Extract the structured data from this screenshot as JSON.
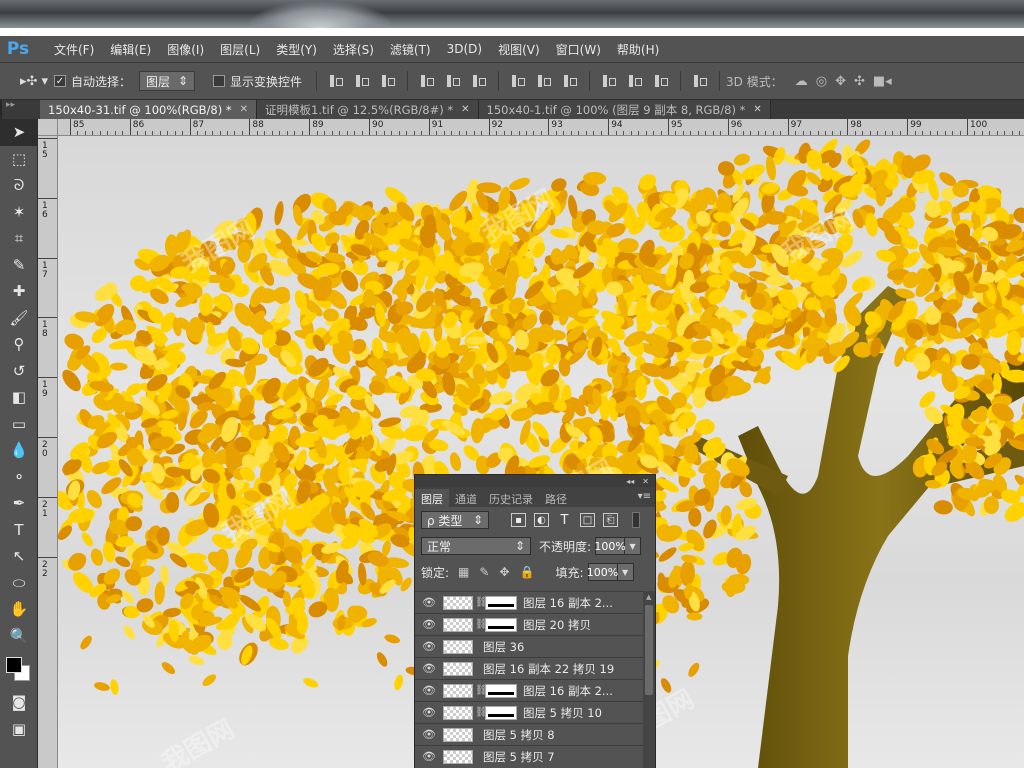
{
  "app": {
    "logo": "Ps"
  },
  "menu": [
    "文件(F)",
    "编辑(E)",
    "图像(I)",
    "图层(L)",
    "类型(Y)",
    "选择(S)",
    "滤镜(T)",
    "3D(D)",
    "视图(V)",
    "窗口(W)",
    "帮助(H)"
  ],
  "options": {
    "tool_icon": "▸✣ ▾",
    "auto_select_checked": true,
    "auto_select_label": "自动选择：",
    "auto_select_target": "图层",
    "show_transform_label": "显示变换控件",
    "show_transform_checked": false,
    "mode_3d_label": "3D 模式："
  },
  "tabs": [
    {
      "label": "150x40-31.tif @ 100%(RGB/8) *",
      "active": true
    },
    {
      "label": "证明模板1.tif @ 12.5%(RGB/8#) *",
      "active": false
    },
    {
      "label": "150x40-1.tif @ 100% (图层 9 副本 8, RGB/8) *",
      "active": false
    }
  ],
  "ruler": {
    "top": [
      "85",
      "86",
      "87",
      "88",
      "89",
      "90",
      "91",
      "92",
      "93",
      "94",
      "95",
      "96",
      "97",
      "98",
      "99",
      "100"
    ],
    "left": [
      "1\n5",
      "1\n6",
      "1\n7",
      "1\n8",
      "1\n9",
      "2\n0",
      "2\n1",
      "2\n2"
    ]
  },
  "tools": [
    "move",
    "marquee",
    "lasso",
    "magic-wand",
    "crop",
    "eyedropper",
    "healing",
    "brush",
    "stamp",
    "history-brush",
    "eraser",
    "gradient",
    "blur",
    "dodge",
    "pen",
    "type",
    "path-select",
    "shape",
    "hand",
    "zoom"
  ],
  "colors": {
    "foreground": "#000000",
    "background": "#ffffff",
    "leaf_light": "#ffd200",
    "leaf_mid": "#f0b400",
    "leaf_dark": "#d98c00",
    "trunk": "#7a6510"
  },
  "layers_panel": {
    "tabs": [
      "图层",
      "通道",
      "历史记录",
      "路径"
    ],
    "filter_label": "ρ 类型",
    "blend_mode": "正常",
    "opacity_label": "不透明度:",
    "opacity_value": "100%",
    "lock_label": "锁定:",
    "fill_label": "填充:",
    "fill_value": "100%",
    "layers": [
      {
        "name": "图层 16 副本 2...",
        "mask": true
      },
      {
        "name": "图层 20 拷贝",
        "mask": true
      },
      {
        "name": "图层 36",
        "mask": false
      },
      {
        "name": "图层 16 副本 22 拷贝 19",
        "mask": false
      },
      {
        "name": "图层 16 副本 2...",
        "mask": true
      },
      {
        "name": "图层 5 拷贝 10",
        "mask": true
      },
      {
        "name": "图层 5 拷贝 8",
        "mask": false
      },
      {
        "name": "图层 5 拷贝 7",
        "mask": false
      }
    ]
  },
  "watermark": "我图网"
}
